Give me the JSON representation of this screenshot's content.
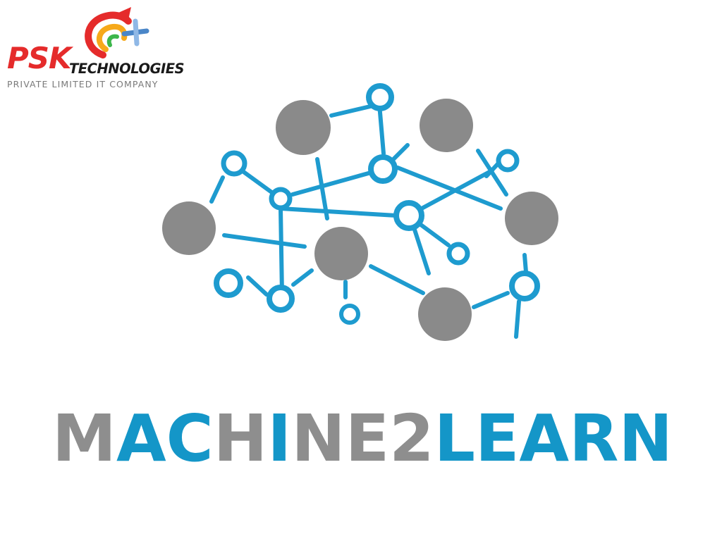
{
  "psk_logo": {
    "name": "PSK",
    "technologies": "TECHNOLOGIES",
    "tagline": "PRIVATE LIMITED IT COMPANY"
  },
  "wordmark": {
    "text_gray_1": "M",
    "text_blue_1": "AC",
    "text_gray_2": "H",
    "text_blue_2": "I",
    "text_gray_3": "NE2",
    "text_blue_3": "LEARN"
  },
  "colors": {
    "brand_red": "#e52b2b",
    "node_blue": "#1e9bcf",
    "node_gray": "#8a8a8a",
    "word_gray": "#8e8e8e",
    "word_blue": "#1496c8"
  }
}
